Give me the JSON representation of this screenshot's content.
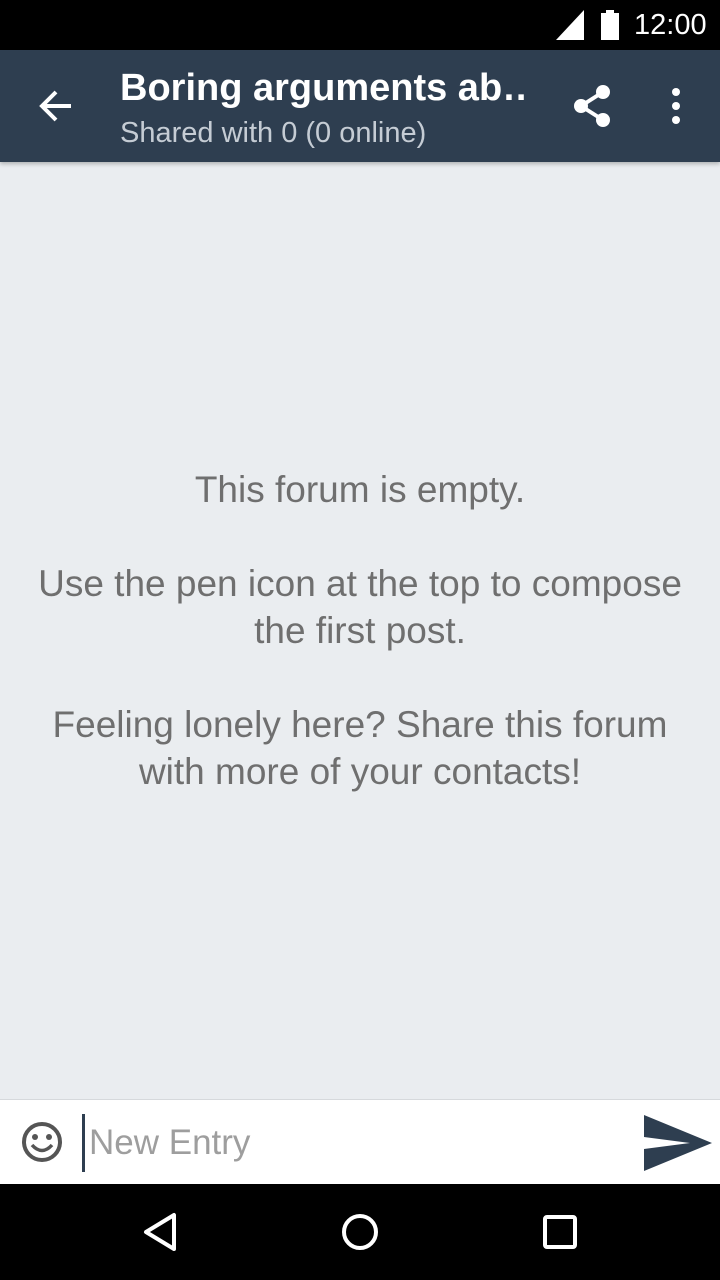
{
  "status_bar": {
    "time": "12:00",
    "icons": [
      "signal-icon",
      "battery-icon"
    ]
  },
  "app_bar": {
    "title": "Boring arguments ab…",
    "subtitle": "Shared with 0 (0 online)",
    "icons": [
      "back-arrow-icon",
      "share-icon",
      "more-vert-icon"
    ],
    "background": "#2e3e50"
  },
  "empty_state": {
    "line1": "This forum is empty.",
    "line2": "Use the pen icon at the top to compose the first post.",
    "line3": "Feeling lonely here? Share this forum with more of your contacts!"
  },
  "composer": {
    "placeholder": "New Entry",
    "value": "",
    "icons": [
      "emoji-icon",
      "send-icon"
    ]
  },
  "nav_bar": {
    "icons": [
      "nav-back-icon",
      "nav-home-icon",
      "nav-recents-icon"
    ]
  },
  "colors": {
    "accent": "#2e3e50",
    "background": "#eaedf0",
    "empty_text": "#6f6f6f"
  }
}
